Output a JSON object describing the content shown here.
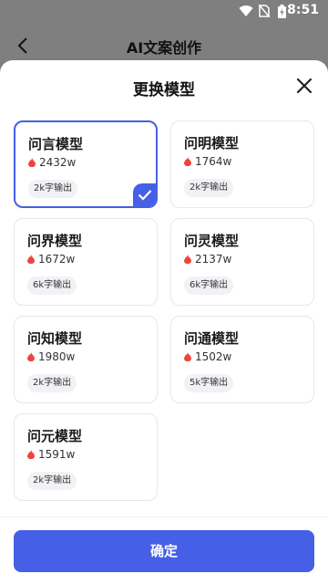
{
  "status": {
    "time": "8:51"
  },
  "appbar": {
    "title": "AI文案创作"
  },
  "sheet": {
    "title": "更换模型",
    "confirm_label": "确定",
    "models": [
      {
        "name": "问言模型",
        "count": "2432w",
        "tag": "2k字输出",
        "selected": true
      },
      {
        "name": "问明模型",
        "count": "1764w",
        "tag": "2k字输出",
        "selected": false
      },
      {
        "name": "问界模型",
        "count": "1672w",
        "tag": "6k字输出",
        "selected": false
      },
      {
        "name": "问灵模型",
        "count": "2137w",
        "tag": "6k字输出",
        "selected": false
      },
      {
        "name": "问知模型",
        "count": "1980w",
        "tag": "2k字输出",
        "selected": false
      },
      {
        "name": "问通模型",
        "count": "1502w",
        "tag": "5k字输出",
        "selected": false
      },
      {
        "name": "问元模型",
        "count": "1591w",
        "tag": "2k字输出",
        "selected": false
      }
    ]
  },
  "colors": {
    "accent": "#4560e6",
    "flame": "#f0433a"
  }
}
